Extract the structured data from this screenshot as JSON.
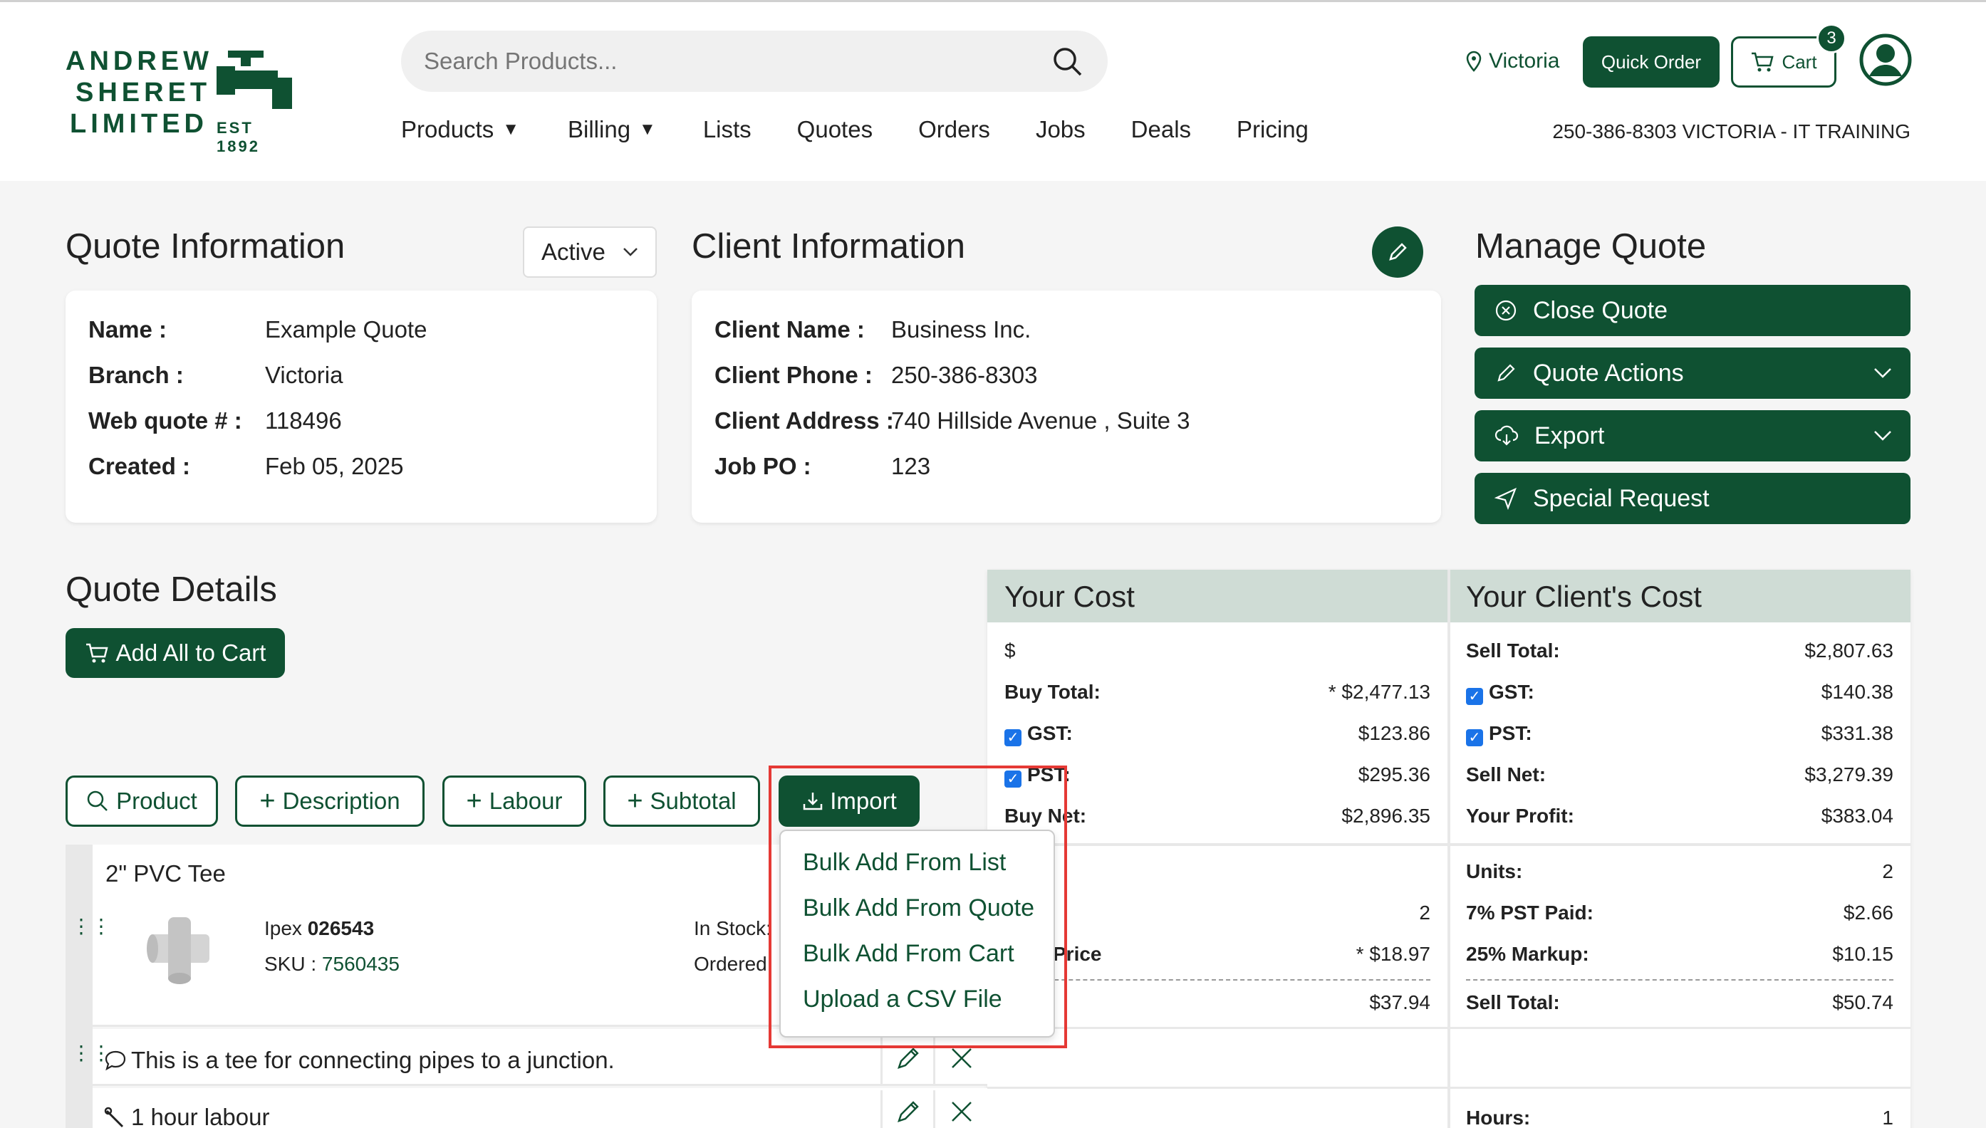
{
  "header": {
    "logo": {
      "line1": "ANDREW",
      "line2": "SHERET",
      "line3": "LIMITED",
      "est": "EST 1892"
    },
    "search_placeholder": "Search Products...",
    "location": "Victoria",
    "quick_order": "Quick Order",
    "cart_label": "Cart",
    "cart_count": "3",
    "account_info": "250-386-8303 VICTORIA - IT TRAINING",
    "nav": [
      "Products",
      "Billing",
      "Lists",
      "Quotes",
      "Orders",
      "Jobs",
      "Deals",
      "Pricing"
    ]
  },
  "quote_info": {
    "title": "Quote Information",
    "status": "Active",
    "fields": [
      {
        "label": "Name :",
        "value": "Example Quote"
      },
      {
        "label": "Branch :",
        "value": "Victoria"
      },
      {
        "label": "Web quote # :",
        "value": "118496"
      },
      {
        "label": "Created :",
        "value": "Feb 05, 2025"
      }
    ]
  },
  "client_info": {
    "title": "Client Information",
    "fields": [
      {
        "label": "Client Name :",
        "value": "Business Inc."
      },
      {
        "label": "Client Phone :",
        "value": "250-386-8303"
      },
      {
        "label": "Client Address :",
        "value": "740 Hillside Avenue , Suite 3"
      },
      {
        "label": "Job PO :",
        "value": "123"
      }
    ]
  },
  "manage_quote": {
    "title": "Manage Quote",
    "buttons": [
      "Close Quote",
      "Quote Actions",
      "Export",
      "Special Request"
    ]
  },
  "quote_details": {
    "title": "Quote Details",
    "add_all": "Add All to Cart",
    "tools": [
      "Product",
      "Description",
      "Labour",
      "Subtotal",
      "Import"
    ],
    "import_menu": [
      "Bulk Add From List",
      "Bulk Add From Quote",
      "Bulk Add From Cart",
      "Upload a CSV File"
    ]
  },
  "your_cost": {
    "title": "Your Cost",
    "currency": "$",
    "buy_total_label": "Buy Total:",
    "buy_total": "* $2,477.13",
    "gst_label": "GST:",
    "gst": "$123.86",
    "pst_label": "PST:",
    "pst": "$295.36",
    "buy_net_label": "Buy Net:",
    "buy_net": "$2,896.35",
    "item_qty": "2",
    "item_price_label": "Price",
    "item_price": "* $18.97",
    "item_total": "$37.94"
  },
  "client_cost": {
    "title": "Your Client's Cost",
    "sell_total_label": "Sell Total:",
    "sell_total": "$2,807.63",
    "gst_label": "GST:",
    "gst": "$140.38",
    "pst_label": "PST:",
    "pst": "$331.38",
    "sell_net_label": "Sell Net:",
    "sell_net": "$3,279.39",
    "profit_label": "Your Profit:",
    "profit": "$383.04",
    "units_label": "Units:",
    "units": "2",
    "pst_paid_label": "7% PST Paid:",
    "pst_paid": "$2.66",
    "markup_label": "25% Markup:",
    "markup": "$10.15",
    "item_sell_total_label": "Sell Total:",
    "item_sell_total": "$50.74",
    "hours_label": "Hours:",
    "hours": "1"
  },
  "line_items": {
    "product": {
      "name": "2\" PVC Tee",
      "brand": "Ipex",
      "part": "026543",
      "sku_label": "SKU :",
      "sku": "7560435",
      "in_stock_label": "In Stock:",
      "ordered_label": "Ordered"
    },
    "description": "This is a tee for connecting pipes to a junction.",
    "labour": "1 hour labour"
  },
  "colors": {
    "brand": "#0f5132",
    "highlight": "#e53935",
    "cost_header": "#cfdcd5"
  }
}
